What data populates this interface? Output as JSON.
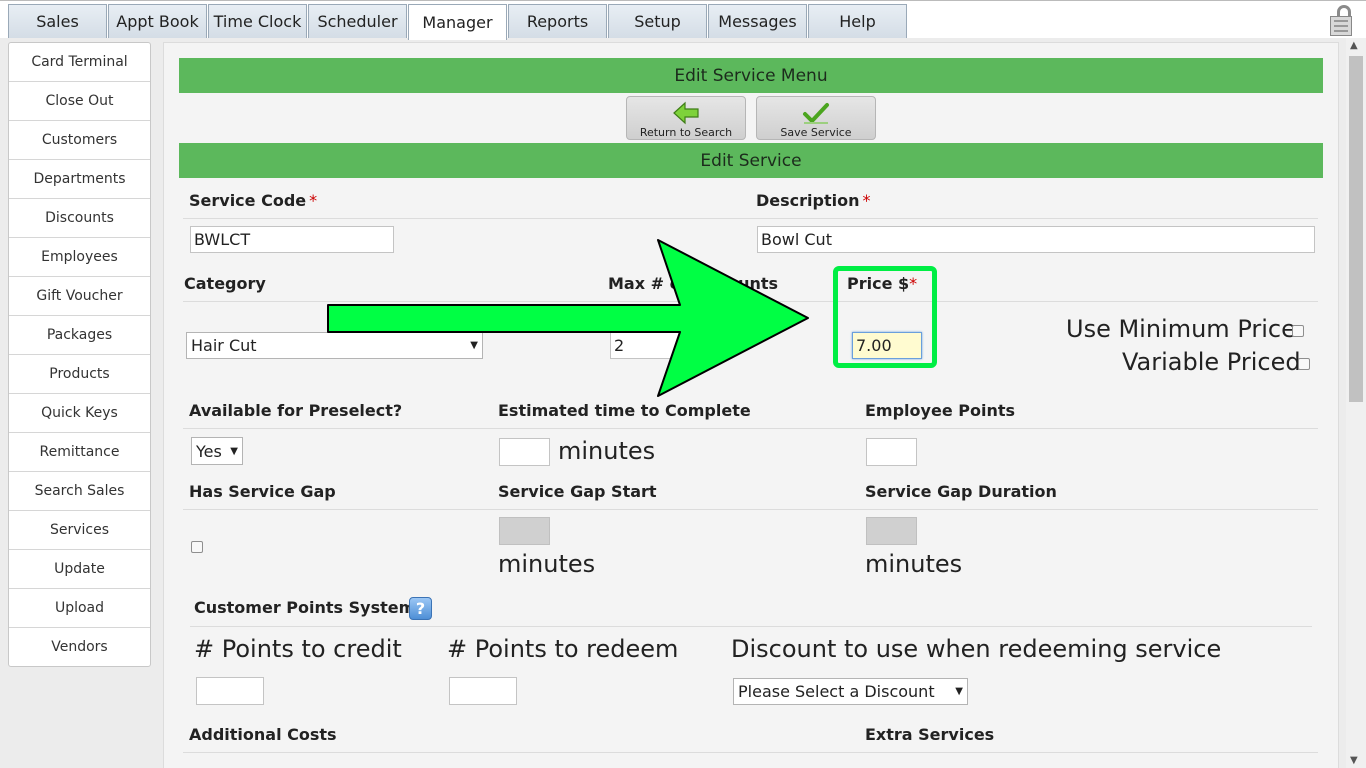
{
  "tabs": [
    "Sales",
    "Appt Book",
    "Time Clock",
    "Scheduler",
    "Manager",
    "Reports",
    "Setup",
    "Messages",
    "Help"
  ],
  "active_tab": "Manager",
  "sidebar": {
    "items": [
      "Card Terminal",
      "Close Out",
      "Customers",
      "Departments",
      "Discounts",
      "Employees",
      "Gift Voucher",
      "Packages",
      "Products",
      "Quick Keys",
      "Remittance",
      "Search Sales",
      "Services",
      "Update",
      "Upload",
      "Vendors"
    ]
  },
  "menu": {
    "title": "Edit Service Menu",
    "return_label": "Return to Search",
    "save_label": "Save Service"
  },
  "form": {
    "section_title": "Edit Service",
    "service_code_label": "Service Code",
    "service_code_value": "BWLCT",
    "description_label": "Description",
    "description_value": "Bowl Cut",
    "category_label": "Category",
    "category_value": "Hair Cut",
    "max_discounts_label": "Max # of Discounts",
    "max_discounts_label_visible": "Max # c",
    "max_discounts_label_tail": "ounts",
    "max_discounts_value": "2",
    "price_label": "Price $",
    "price_value": "7.00",
    "use_min_price_label": "Use Minimum Price",
    "variable_priced_label": "Variable Priced",
    "preselect_label": "Available for Preselect?",
    "preselect_value": "Yes",
    "est_time_label": "Estimated time to Complete",
    "minutes_label": "minutes",
    "employee_points_label": "Employee Points",
    "has_gap_label": "Has Service Gap",
    "gap_start_label": "Service Gap Start",
    "gap_duration_label": "Service Gap Duration",
    "points_system_label": "Customer Points System",
    "points_credit_label": "# Points to credit",
    "points_redeem_label": "# Points to redeem",
    "discount_redeem_label": "Discount to use when redeeming service",
    "discount_select_value": "Please Select a Discount",
    "additional_costs_label": "Additional Costs",
    "extra_services_label": "Extra Services",
    "required_mark": "*",
    "help_glyph": "?"
  },
  "colors": {
    "header_green": "#5cb85c",
    "highlight_green": "#00ee44",
    "arrow_green": "#00ff44"
  }
}
